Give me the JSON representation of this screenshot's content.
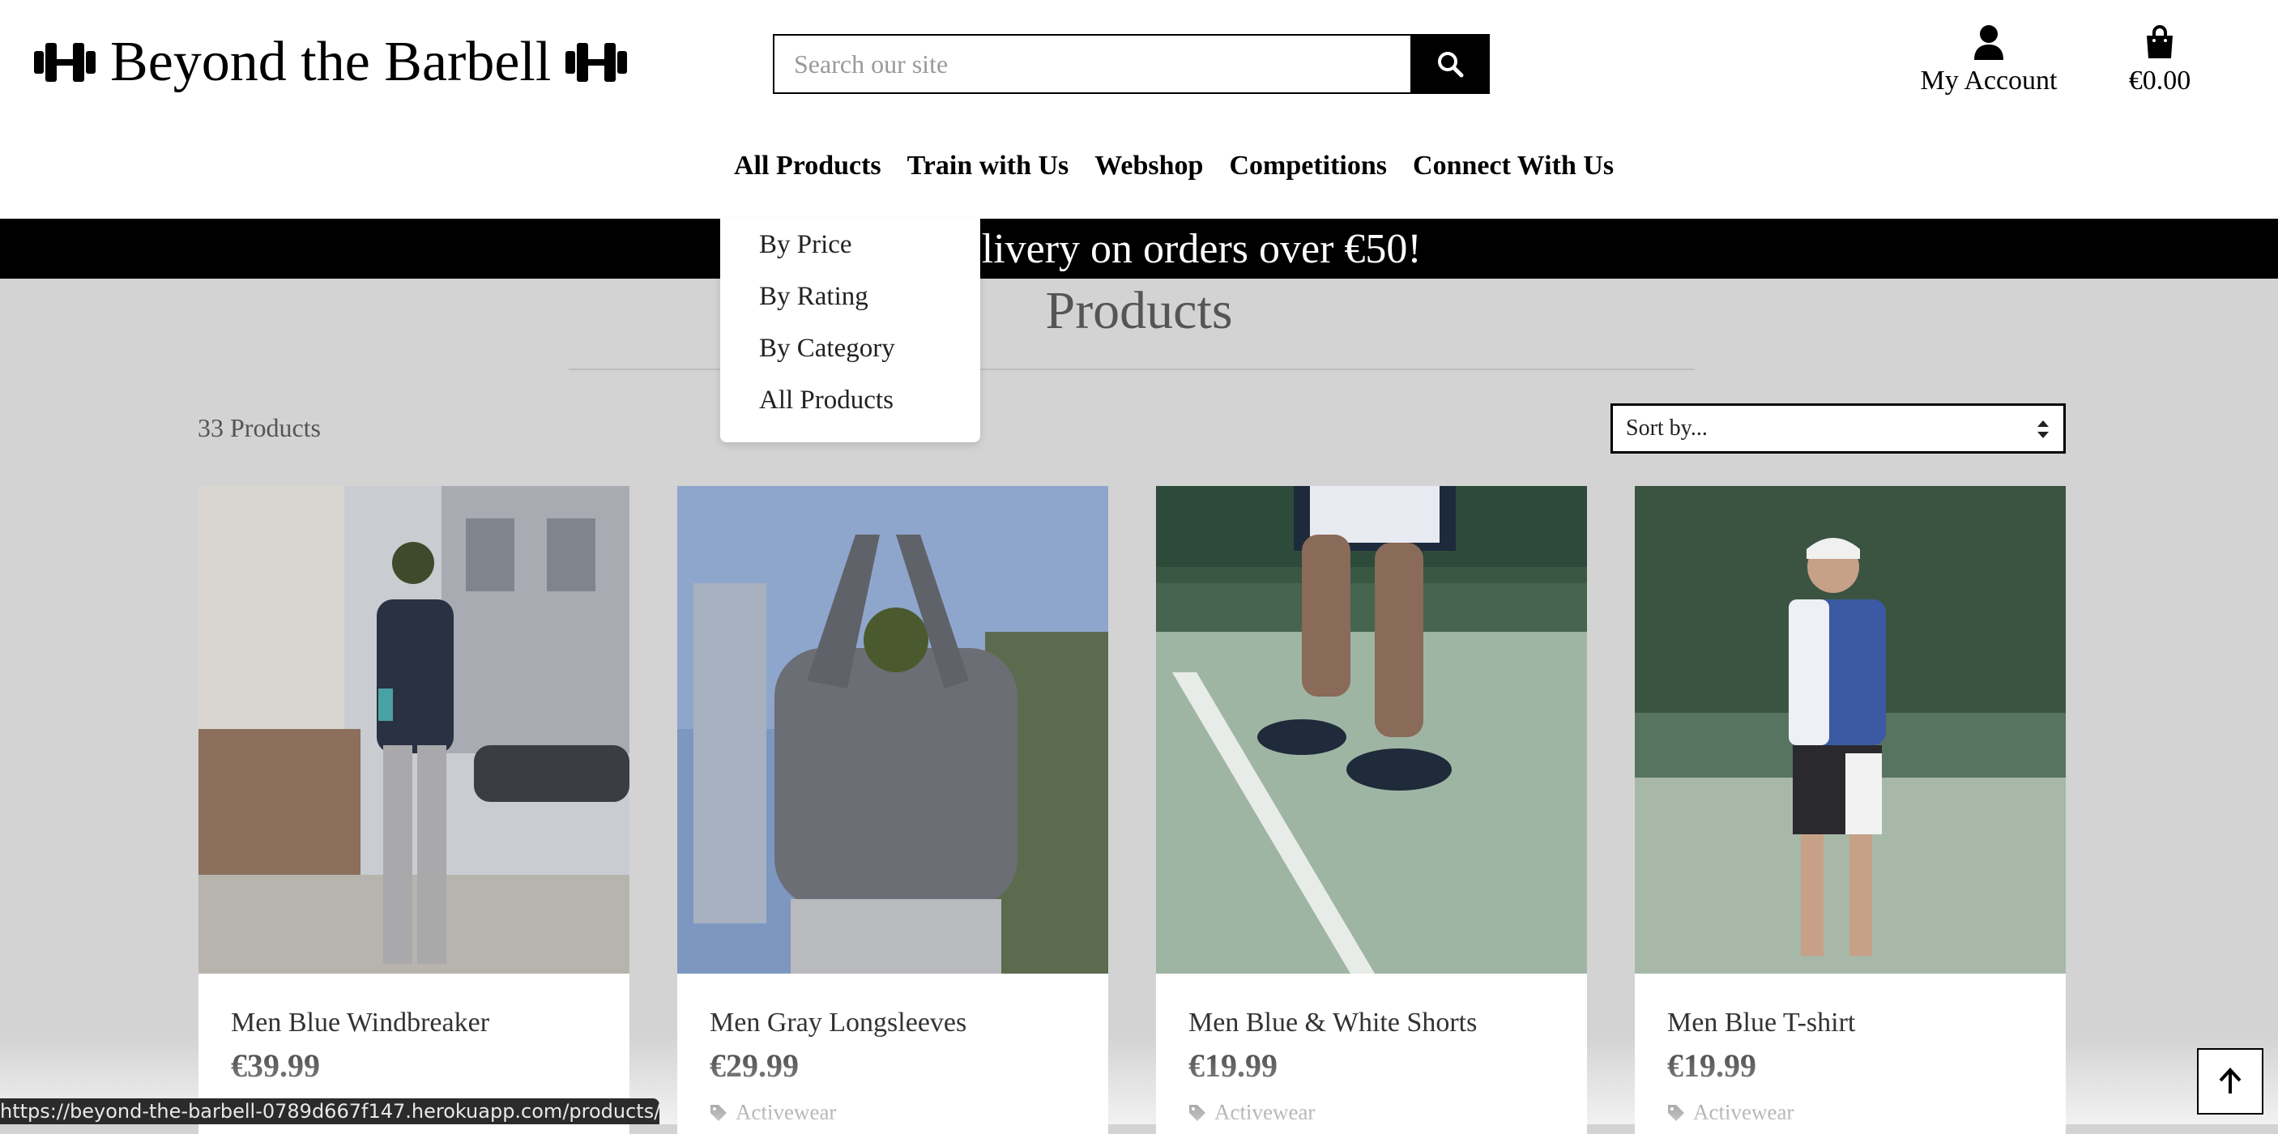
{
  "header": {
    "brand": "Beyond the Barbell",
    "search_placeholder": "Search our site",
    "account_label": "My Account",
    "bag_total": "€0.00"
  },
  "nav": {
    "items": [
      "All Products",
      "Train with Us",
      "Webshop",
      "Competitions",
      "Connect With Us"
    ]
  },
  "banner": {
    "text": "Free delivery on orders over €50!"
  },
  "dropdown": {
    "items": [
      "By Price",
      "By Rating",
      "By Category",
      "All Products"
    ]
  },
  "main": {
    "title": "Products",
    "count": "33 Products",
    "sort_placeholder": "Sort by..."
  },
  "products": [
    {
      "name": "Men Blue Windbreaker",
      "price": "€39.99",
      "category": ""
    },
    {
      "name": "Men Gray Longsleeves",
      "price": "€29.99",
      "category": "Activewear"
    },
    {
      "name": "Men Blue & White Shorts",
      "price": "€19.99",
      "category": "Activewear"
    },
    {
      "name": "Men Blue T-shirt",
      "price": "€19.99",
      "category": "Activewear"
    }
  ],
  "status_url": "https://beyond-the-barbell-0789d667f147.herokuapp.com/products/#",
  "colors": {
    "accent": "#000000",
    "page_bg": "#d3d3d3",
    "banner_bg": "#000000"
  }
}
